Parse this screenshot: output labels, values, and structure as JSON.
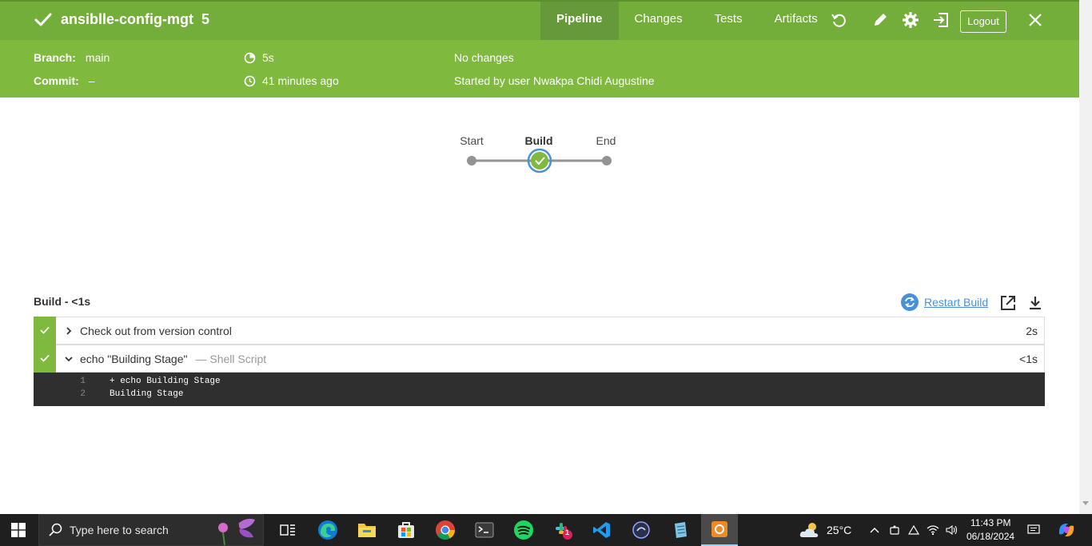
{
  "header": {
    "job_title": "ansiblle-config-mgt",
    "run_number": "5",
    "tabs": [
      "Pipeline",
      "Changes",
      "Tests",
      "Artifacts"
    ],
    "active_tab": "Pipeline",
    "logout_label": "Logout",
    "accent_color": "#73ad3a"
  },
  "summary": {
    "branch_label": "Branch:",
    "branch_value": "main",
    "commit_label": "Commit:",
    "commit_value": "–",
    "duration": "5s",
    "started_ago": "41 minutes ago",
    "changes": "No changes",
    "started_by": "Started by user Nwakpa Chidi Augustine"
  },
  "pipeline": {
    "stages": [
      "Start",
      "Build",
      "End"
    ],
    "active_stage": "Build"
  },
  "stage_detail": {
    "title": "Build - <1s",
    "restart_label": "Restart Build",
    "steps": [
      {
        "name": "Check out from version control",
        "sub": "",
        "duration": "2s",
        "status": "success",
        "expanded": false
      },
      {
        "name": "echo \"Building Stage\"",
        "sub": "— Shell Script",
        "duration": "<1s",
        "status": "success",
        "expanded": true
      }
    ],
    "log": [
      {
        "n": "1",
        "text": "+ echo Building Stage"
      },
      {
        "n": "2",
        "text": "Building Stage"
      }
    ]
  },
  "taskbar": {
    "search_placeholder": "Type here to search",
    "temperature": "25°C",
    "time": "11:43 PM",
    "date": "06/18/2024",
    "slack_badge": "1"
  }
}
